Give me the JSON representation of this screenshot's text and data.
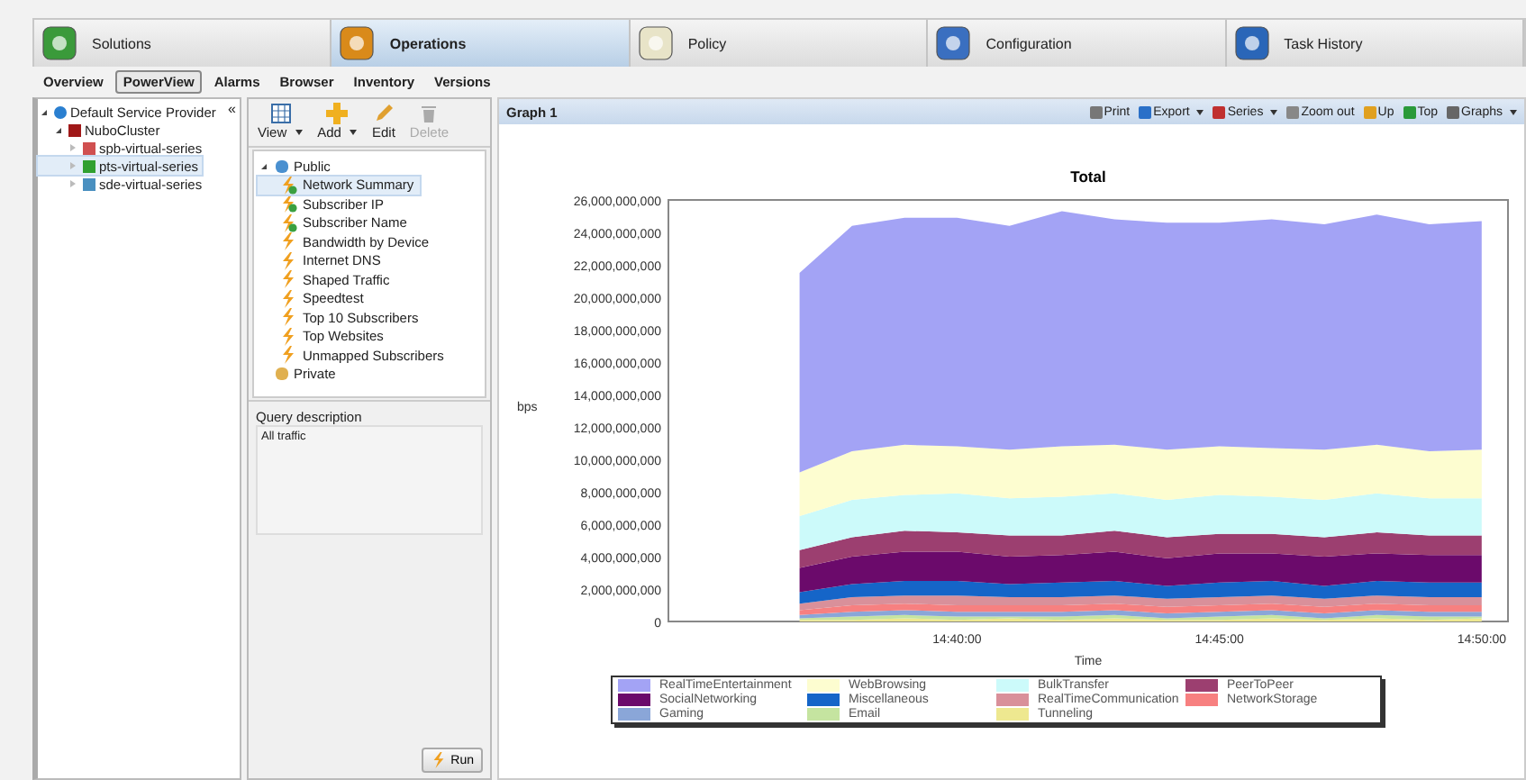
{
  "main_tabs": [
    {
      "label": "Solutions",
      "selected": false
    },
    {
      "label": "Operations",
      "selected": true
    },
    {
      "label": "Policy",
      "selected": false
    },
    {
      "label": "Configuration",
      "selected": false
    },
    {
      "label": "Task History",
      "selected": false
    }
  ],
  "sub_tabs": [
    {
      "label": "Overview",
      "selected": false
    },
    {
      "label": "PowerView",
      "selected": true
    },
    {
      "label": "Alarms",
      "selected": false
    },
    {
      "label": "Browser",
      "selected": false
    },
    {
      "label": "Inventory",
      "selected": false
    },
    {
      "label": "Versions",
      "selected": false
    }
  ],
  "device_tree": {
    "collapse_glyph": "«",
    "items": [
      {
        "label": "Default Service Provider",
        "kind": "provider",
        "expanded": true,
        "selected": false,
        "children": [
          {
            "label": "NuboCluster",
            "kind": "cluster",
            "expanded": true,
            "selected": false,
            "children": [
              {
                "label": "spb-virtual-series",
                "kind": "device-red",
                "expanded": false,
                "selected": false
              },
              {
                "label": "pts-virtual-series",
                "kind": "device-green",
                "expanded": false,
                "selected": true
              },
              {
                "label": "sde-virtual-series",
                "kind": "device-blue",
                "expanded": false,
                "selected": false
              }
            ]
          }
        ]
      }
    ]
  },
  "query_toolbar": [
    {
      "label": "View",
      "kind": "view",
      "dropdown": true,
      "disabled": false
    },
    {
      "label": "Add",
      "kind": "add",
      "dropdown": true,
      "disabled": false
    },
    {
      "label": "Edit",
      "kind": "edit",
      "dropdown": false,
      "disabled": false
    },
    {
      "label": "Delete",
      "kind": "delete",
      "dropdown": false,
      "disabled": true
    }
  ],
  "query_tree": [
    {
      "label": "Public",
      "kind": "public-folder",
      "expanded": true,
      "selected": false,
      "children": [
        {
          "label": "Network Summary",
          "kind": "shared-query",
          "selected": true
        },
        {
          "label": "Subscriber IP",
          "kind": "shared-query",
          "selected": false
        },
        {
          "label": "Subscriber Name",
          "kind": "shared-query",
          "selected": false
        },
        {
          "label": "Bandwidth by Device",
          "kind": "query",
          "selected": false
        },
        {
          "label": "Internet DNS",
          "kind": "query",
          "selected": false
        },
        {
          "label": "Shaped Traffic",
          "kind": "query",
          "selected": false
        },
        {
          "label": "Speedtest",
          "kind": "query",
          "selected": false
        },
        {
          "label": "Top 10 Subscribers",
          "kind": "query",
          "selected": false
        },
        {
          "label": "Top Websites",
          "kind": "query",
          "selected": false
        },
        {
          "label": "Unmapped Subscribers",
          "kind": "query",
          "selected": false
        }
      ]
    },
    {
      "label": "Private",
      "kind": "private-folder",
      "expanded": false,
      "selected": false
    }
  ],
  "query_description": {
    "label": "Query description",
    "value": "All traffic"
  },
  "run_button": "Run",
  "graph": {
    "title": "Graph 1",
    "toolbar": [
      {
        "label": "Print",
        "kind": "print",
        "dropdown": false
      },
      {
        "label": "Export",
        "kind": "export",
        "dropdown": true
      },
      {
        "label": "Series",
        "kind": "series",
        "dropdown": true
      },
      {
        "label": "Zoom out",
        "kind": "zoom",
        "dropdown": false
      },
      {
        "label": "Up",
        "kind": "up",
        "dropdown": false
      },
      {
        "label": "Top",
        "kind": "top",
        "dropdown": false
      },
      {
        "label": "Graphs",
        "kind": "graphs",
        "dropdown": true
      }
    ],
    "chart_data": {
      "type": "area",
      "title": "Total",
      "xlabel": "Time",
      "ylabel": "bps",
      "stacked": true,
      "categories": [
        null,
        null,
        null,
        null,
        null,
        "14:40:00",
        null,
        null,
        null,
        null,
        "14:45:00",
        null,
        null,
        null,
        null,
        "14:50:00"
      ],
      "ylim": [
        0,
        26000000000
      ],
      "legend": "bottom",
      "yticks": [
        {
          "value": 0,
          "label": "0"
        },
        {
          "value": 2000000000,
          "label": "2,000,000,000"
        },
        {
          "value": 4000000000,
          "label": "4,000,000,000"
        },
        {
          "value": 6000000000,
          "label": "6,000,000,000"
        },
        {
          "value": 8000000000,
          "label": "8,000,000,000"
        },
        {
          "value": 10000000000,
          "label": "10,000,000,000"
        },
        {
          "value": 12000000000,
          "label": "12,000,000,000"
        },
        {
          "value": 14000000000,
          "label": "14,000,000,000"
        },
        {
          "value": 16000000000,
          "label": "16,000,000,000"
        },
        {
          "value": 18000000000,
          "label": "18,000,000,000"
        },
        {
          "value": 20000000000,
          "label": "20,000,000,000"
        },
        {
          "value": 22000000000,
          "label": "22,000,000,000"
        },
        {
          "value": 24000000000,
          "label": "24,000,000,000"
        },
        {
          "value": 26000000000,
          "label": "26,000,000,000"
        }
      ],
      "series": [
        {
          "name": "Tunneling",
          "color": "#eee890",
          "values": [
            null,
            null,
            100000000,
            100000000,
            200000000,
            100000000,
            200000000,
            100000000,
            200000000,
            100000000,
            100000000,
            200000000,
            100000000,
            200000000,
            100000000,
            200000000
          ]
        },
        {
          "name": "Email",
          "color": "#c5e4a0",
          "values": [
            null,
            null,
            100000000,
            200000000,
            200000000,
            200000000,
            100000000,
            200000000,
            200000000,
            100000000,
            200000000,
            200000000,
            100000000,
            200000000,
            200000000,
            100000000
          ]
        },
        {
          "name": "Gaming",
          "color": "#8aa6d8",
          "values": [
            null,
            null,
            200000000,
            300000000,
            300000000,
            300000000,
            300000000,
            300000000,
            300000000,
            300000000,
            300000000,
            300000000,
            300000000,
            300000000,
            300000000,
            300000000
          ]
        },
        {
          "name": "NetworkStorage",
          "color": "#f78080",
          "values": [
            null,
            null,
            300000000,
            400000000,
            400000000,
            400000000,
            400000000,
            400000000,
            400000000,
            400000000,
            400000000,
            400000000,
            400000000,
            400000000,
            400000000,
            400000000
          ]
        },
        {
          "name": "RealTimeCommunication",
          "color": "#d9909a",
          "values": [
            null,
            null,
            400000000,
            500000000,
            500000000,
            600000000,
            500000000,
            500000000,
            500000000,
            500000000,
            500000000,
            500000000,
            500000000,
            500000000,
            500000000,
            500000000
          ]
        },
        {
          "name": "Miscellaneous",
          "color": "#1565c8",
          "values": [
            null,
            null,
            700000000,
            800000000,
            900000000,
            900000000,
            800000000,
            900000000,
            900000000,
            800000000,
            900000000,
            900000000,
            800000000,
            900000000,
            900000000,
            900000000
          ]
        },
        {
          "name": "SocialNetworking",
          "color": "#6b0a6b",
          "values": [
            null,
            null,
            1500000000,
            1700000000,
            1800000000,
            1800000000,
            1700000000,
            1700000000,
            1800000000,
            1700000000,
            1800000000,
            1700000000,
            1800000000,
            1700000000,
            1700000000,
            1700000000
          ]
        },
        {
          "name": "PeerToPeer",
          "color": "#9c3f70",
          "values": [
            null,
            null,
            1100000000,
            1200000000,
            1300000000,
            1200000000,
            1300000000,
            1200000000,
            1300000000,
            1300000000,
            1200000000,
            1200000000,
            1200000000,
            1300000000,
            1200000000,
            1200000000
          ]
        },
        {
          "name": "BulkTransfer",
          "color": "#ccfafa",
          "values": [
            null,
            null,
            2100000000,
            2300000000,
            2200000000,
            2400000000,
            2300000000,
            2400000000,
            2300000000,
            2300000000,
            2400000000,
            2300000000,
            2300000000,
            2400000000,
            2300000000,
            2300000000
          ]
        },
        {
          "name": "WebBrowsing",
          "color": "#fdfdd0",
          "values": [
            null,
            null,
            2700000000,
            3000000000,
            3100000000,
            2900000000,
            3000000000,
            3100000000,
            3000000000,
            3100000000,
            3000000000,
            3000000000,
            3100000000,
            3000000000,
            2900000000,
            3000000000
          ]
        },
        {
          "name": "RealTimeEntertainment",
          "color": "#a3a3f5",
          "values": [
            null,
            null,
            12300000000,
            13900000000,
            14000000000,
            14100000000,
            13800000000,
            14500000000,
            13900000000,
            14000000000,
            13800000000,
            14100000000,
            13900000000,
            14200000000,
            14000000000,
            14100000000
          ]
        }
      ]
    }
  }
}
